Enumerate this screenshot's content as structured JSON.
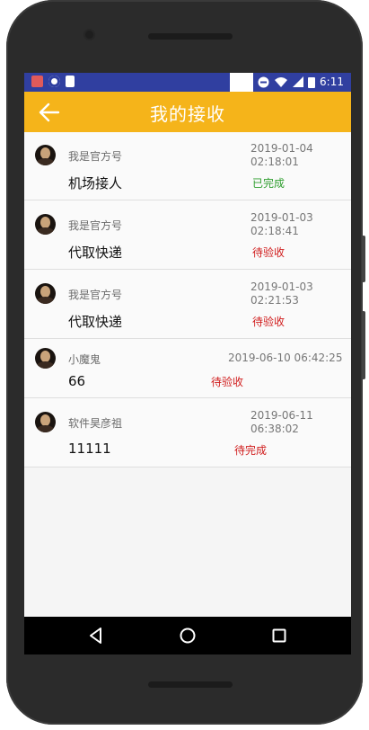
{
  "statusbar": {
    "time": "6:11"
  },
  "appbar": {
    "title": "我的接收"
  },
  "colors": {
    "appbar": "#f5b41a",
    "statusbar": "#303fa0",
    "done": "#2e9e2e",
    "pending": "#d01c1c"
  },
  "items": [
    {
      "sender": "我是官方号",
      "time_line1": "2019-01-04",
      "time_line2": "02:18:01",
      "task": "机场接人",
      "status": "已完成",
      "status_type": "done"
    },
    {
      "sender": "我是官方号",
      "time_line1": "2019-01-03",
      "time_line2": "02:18:41",
      "task": "代取快递",
      "status": "待验收",
      "status_type": "pending"
    },
    {
      "sender": "我是官方号",
      "time_line1": "2019-01-03",
      "time_line2": "02:21:53",
      "task": "代取快递",
      "status": "待验收",
      "status_type": "pending"
    },
    {
      "sender": "小魔鬼",
      "time_line1": "2019-06-10 06:42:25",
      "time_line2": "",
      "task": "66",
      "status": "待验收",
      "status_type": "pending"
    },
    {
      "sender": "软件昊彦祖",
      "time_line1": "2019-06-11",
      "time_line2": "06:38:02",
      "task": "11111",
      "status": "待完成",
      "status_type": "pending"
    }
  ]
}
